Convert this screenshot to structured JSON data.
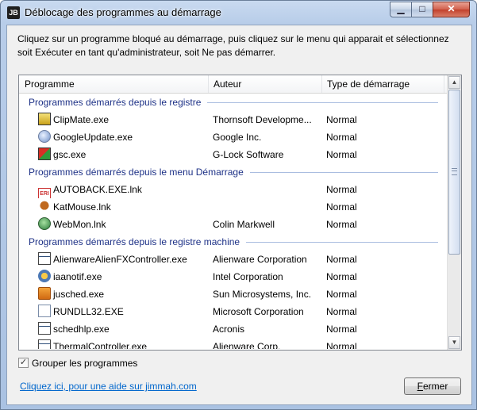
{
  "window": {
    "title": "Déblocage des programmes au démarrage",
    "app_icon_text": "JB",
    "controls": {
      "minimize": "▁",
      "maximize": "□",
      "close": "✕"
    }
  },
  "instructions": "Cliquez sur un programme bloqué au démarrage, puis cliquez sur le menu qui apparait et sélectionnez soit Exécuter en tant qu'administrateur, soit Ne pas démarrer.",
  "table": {
    "columns": [
      "Programme",
      "Auteur",
      "Type de démarrage"
    ],
    "groups": [
      {
        "title": "Programmes démarrés depuis le registre",
        "rows": [
          {
            "program": "ClipMate.exe",
            "author": "Thornsoft Developme...",
            "type": "Normal",
            "icon": "clipmate-icon"
          },
          {
            "program": "GoogleUpdate.exe",
            "author": "Google Inc.",
            "type": "Normal",
            "icon": "google-update-icon"
          },
          {
            "program": "gsc.exe",
            "author": "G-Lock Software",
            "type": "Normal",
            "icon": "gsc-icon"
          }
        ]
      },
      {
        "title": "Programmes démarrés depuis le menu Démarrage",
        "rows": [
          {
            "program": "AUTOBACK.EXE.lnk",
            "author": "",
            "type": "Normal",
            "icon": "autoback-icon"
          },
          {
            "program": "KatMouse.lnk",
            "author": "",
            "type": "Normal",
            "icon": "katmouse-icon"
          },
          {
            "program": "WebMon.lnk",
            "author": "Colin Markwell",
            "type": "Normal",
            "icon": "webmon-icon"
          }
        ]
      },
      {
        "title": "Programmes démarrés depuis le registre machine",
        "rows": [
          {
            "program": "AlienwareAlienFXController.exe",
            "author": "Alienware Corporation",
            "type": "Normal",
            "icon": "app-window-icon"
          },
          {
            "program": "iaanotif.exe",
            "author": "Intel Corporation",
            "type": "Normal",
            "icon": "intel-icon"
          },
          {
            "program": "jusched.exe",
            "author": "Sun Microsystems, Inc.",
            "type": "Normal",
            "icon": "java-icon"
          },
          {
            "program": "RUNDLL32.EXE",
            "author": "Microsoft Corporation",
            "type": "Normal",
            "icon": "document-icon"
          },
          {
            "program": "schedhlp.exe",
            "author": "Acronis",
            "type": "Normal",
            "icon": "app-window-icon"
          },
          {
            "program": "ThermalController.exe",
            "author": "Alienware Corp.",
            "type": "Normal",
            "icon": "app-window-icon"
          }
        ]
      }
    ]
  },
  "group_checkbox": {
    "label": "Grouper les programmes",
    "checked": true
  },
  "help_link": "Cliquez ici, pour une aide sur jimmah.com",
  "close_button": "Fermer"
}
